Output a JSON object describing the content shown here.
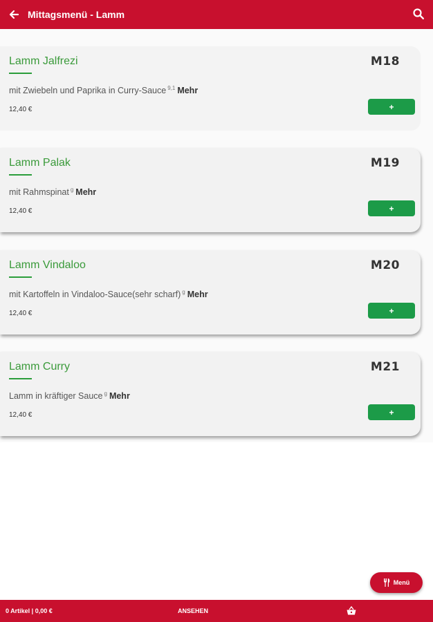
{
  "header": {
    "title": "Mittagsmenü - Lamm",
    "back_icon": "arrow-left-icon",
    "search_icon": "search-icon"
  },
  "items": [
    {
      "name": "Lamm Jalfrezi",
      "code": "M18",
      "description": "mit Zwiebeln und Paprika in Curry-Sauce",
      "allergens": "9,1",
      "more": "Mehr",
      "price": "12,40 €",
      "add_label": "+"
    },
    {
      "name": "Lamm Palak",
      "code": "M19",
      "description": "mit Rahmspinat",
      "allergens": "g",
      "more": "Mehr",
      "price": "12,40 €",
      "add_label": "+"
    },
    {
      "name": "Lamm Vindaloo",
      "code": "M20",
      "description": "mit Kartoffeln in Vindaloo-Sauce(sehr scharf)",
      "allergens": "g",
      "more": "Mehr",
      "price": "12,40 €",
      "add_label": "+"
    },
    {
      "name": "Lamm Curry",
      "code": "M21",
      "description": "Lamm in kräftiger Sauce",
      "allergens": "g",
      "more": "Mehr",
      "price": "12,40 €",
      "add_label": "+"
    }
  ],
  "fab": {
    "label": "Menü",
    "icon": "cutlery-icon"
  },
  "footer": {
    "summary": "0 Artikel |  0,00 €",
    "view_label": "ANSEHEN",
    "basket_icon": "basket-icon"
  },
  "colors": {
    "brand": "#c8102e",
    "accent_green": "#1c9b48",
    "title_green": "#3a9a3a"
  }
}
